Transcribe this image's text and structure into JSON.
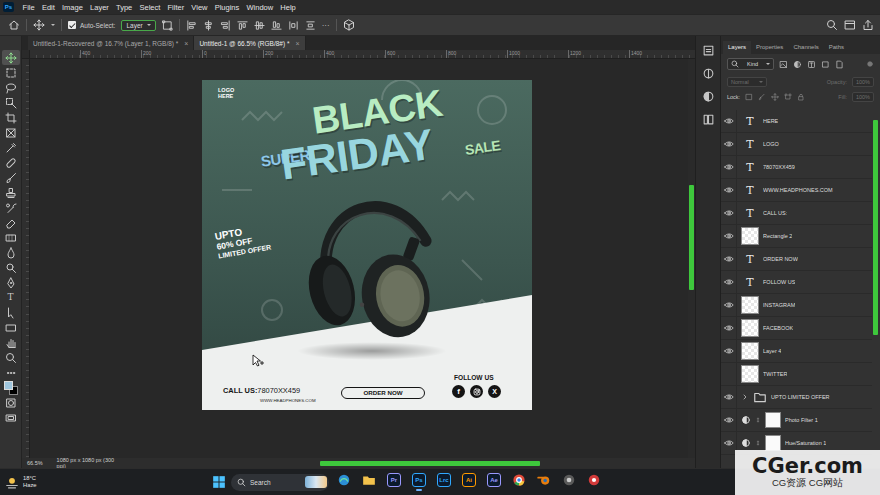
{
  "menubar": {
    "app_icon": "Ps",
    "items": [
      "File",
      "Edit",
      "Image",
      "Layer",
      "Type",
      "Select",
      "Filter",
      "View",
      "Plugins",
      "Window",
      "Help"
    ]
  },
  "options_bar": {
    "auto_select": {
      "label": "Auto-Select:",
      "checked": true
    },
    "target": "Layer",
    "more": "···"
  },
  "toolbar": {
    "tools": [
      {
        "kind": "move",
        "selected": true
      },
      {
        "kind": "marquee",
        "selected": false
      },
      {
        "kind": "lasso",
        "selected": false
      },
      {
        "kind": "objsel",
        "selected": false
      },
      {
        "kind": "crop",
        "selected": false
      },
      {
        "kind": "frame",
        "selected": false
      },
      {
        "kind": "eyedropper",
        "selected": false
      },
      {
        "kind": "healing",
        "selected": false
      },
      {
        "kind": "brush",
        "selected": false
      },
      {
        "kind": "stamp",
        "selected": false
      },
      {
        "kind": "history",
        "selected": false
      },
      {
        "kind": "eraser",
        "selected": false
      },
      {
        "kind": "gradient",
        "selected": false
      },
      {
        "kind": "blur",
        "selected": false
      },
      {
        "kind": "dodge",
        "selected": false
      },
      {
        "kind": "pen",
        "selected": false
      },
      {
        "kind": "type",
        "glyph": "T",
        "selected": false
      },
      {
        "kind": "pathsel",
        "selected": false
      },
      {
        "kind": "rect",
        "selected": false
      },
      {
        "kind": "hand",
        "selected": false
      },
      {
        "kind": "zoom",
        "selected": false
      },
      {
        "kind": "more",
        "selected": false
      },
      {
        "kind": "swatches",
        "foreground_color": "#9fc6de",
        "selected": false
      },
      {
        "kind": "quickmask",
        "selected": false
      },
      {
        "kind": "screenmode",
        "selected": false
      }
    ]
  },
  "document_tabs": [
    {
      "label": "Untitled-1-Recovered @ 16.7% (Layer 1, RGB/8) *",
      "close": "×",
      "selected": false
    },
    {
      "label": "Untitled-1 @ 66.5% (RGB/8#) *",
      "close": "×",
      "selected": true
    }
  ],
  "ruler": {
    "ticks": [
      "400",
      "200",
      "0",
      "200",
      "400",
      "600",
      "800",
      "1000",
      "1200",
      "1400"
    ]
  },
  "artwork": {
    "logo": [
      "LOGO",
      "HERE"
    ],
    "headline": {
      "black": "BLACK",
      "super": "SUPER",
      "friday": "FRIDAY",
      "sale": "SALE"
    },
    "offer": [
      "UPTO",
      "60% OFF",
      "LIMITED OFFER"
    ],
    "call_label": "CALL US:",
    "phone": "78070XX459",
    "website": "WWW.HEADPHONES.COM",
    "order_button": "ORDER NOW",
    "follow": "FOLLOW US",
    "social": [
      {
        "kind": "facebook",
        "glyph": "f"
      },
      {
        "kind": "instagram"
      },
      {
        "kind": "x",
        "glyph": "X"
      }
    ]
  },
  "status_bar": {
    "zoom": "66.5%",
    "doc_size": "1080 px x 1080 px (300 ppi)"
  },
  "icon_strip": [
    {
      "kind": "history"
    },
    {
      "kind": "color"
    },
    {
      "kind": "adjust"
    },
    {
      "kind": "libraries"
    }
  ],
  "layers_panel": {
    "tabs": [
      {
        "label": "Layers",
        "selected": true
      },
      {
        "label": "Properties",
        "selected": false
      },
      {
        "label": "Channels",
        "selected": false
      },
      {
        "label": "Paths",
        "selected": false
      }
    ],
    "filter": "Kind",
    "blend_mode": {
      "value": "Normal",
      "disabled": true
    },
    "opacity": {
      "label": "Opacity:",
      "value": "100%",
      "disabled": true
    },
    "lock_label": "Lock:",
    "fill": {
      "label": "Fill:",
      "value": "100%",
      "disabled": true
    },
    "layers": [
      {
        "name": "HERE",
        "kind": "text",
        "thumb": "T",
        "visible": true,
        "selected": false
      },
      {
        "name": "LOGO",
        "kind": "text",
        "thumb": "T",
        "visible": true,
        "selected": false
      },
      {
        "name": "78070XX459",
        "kind": "text",
        "thumb": "T",
        "visible": true,
        "selected": false
      },
      {
        "name": "WWW.HEADPHONES.COM",
        "kind": "text",
        "thumb": "T",
        "visible": true,
        "selected": false
      },
      {
        "name": "CALL US:",
        "kind": "text",
        "thumb": "T",
        "visible": true,
        "selected": false
      },
      {
        "name": "Rectangle 2",
        "kind": "pixel",
        "visible": true,
        "selected": false
      },
      {
        "name": "ORDER NOW",
        "kind": "text",
        "thumb": "T",
        "visible": true,
        "selected": false
      },
      {
        "name": "FOLLOW US",
        "kind": "text",
        "thumb": "T",
        "visible": true,
        "selected": false
      },
      {
        "name": "INSTAGRAM",
        "kind": "pixel",
        "visible": true,
        "selected": false
      },
      {
        "name": "FACEBOOK",
        "kind": "pixel",
        "visible": true,
        "selected": false
      },
      {
        "name": "Layer 4",
        "kind": "pixel",
        "visible": true,
        "selected": false
      },
      {
        "name": "TWITTER",
        "kind": "pixel",
        "visible": false,
        "selected": false
      },
      {
        "name": "UPTO LIMITED OFFER",
        "kind": "group",
        "expanded": false,
        "visible": true,
        "selected": false
      },
      {
        "name": "Photo Filter 1",
        "kind": "adjustment",
        "visible": true,
        "selected": false
      },
      {
        "name": "Hue/Saturation 1",
        "kind": "adjustment",
        "visible": true,
        "selected": false
      }
    ]
  },
  "taskbar": {
    "weather": {
      "temp": "18°C",
      "condition": "Haze"
    },
    "search": "Search",
    "apps": [
      {
        "kind": "browser",
        "active": false
      },
      {
        "kind": "folder",
        "active": false
      },
      {
        "kind": "badge",
        "label": "Pr",
        "color": "#9999ff",
        "active": false
      },
      {
        "kind": "badge",
        "label": "Ps",
        "color": "#31a8ff",
        "active": true
      },
      {
        "kind": "badge",
        "label": "Lrc",
        "color": "#31a8ff",
        "active": false
      },
      {
        "kind": "badge",
        "label": "Ai",
        "color": "#ff9a00",
        "active": false
      },
      {
        "kind": "badge",
        "label": "Ae",
        "color": "#9999ff",
        "active": false
      },
      {
        "kind": "chrome",
        "active": false
      },
      {
        "kind": "blender",
        "active": false
      },
      {
        "kind": "app",
        "active": false
      },
      {
        "kind": "recorder",
        "active": false
      }
    ]
  },
  "watermark": {
    "title": "CGer.com",
    "subtitle": "CG资源 CG网站"
  }
}
